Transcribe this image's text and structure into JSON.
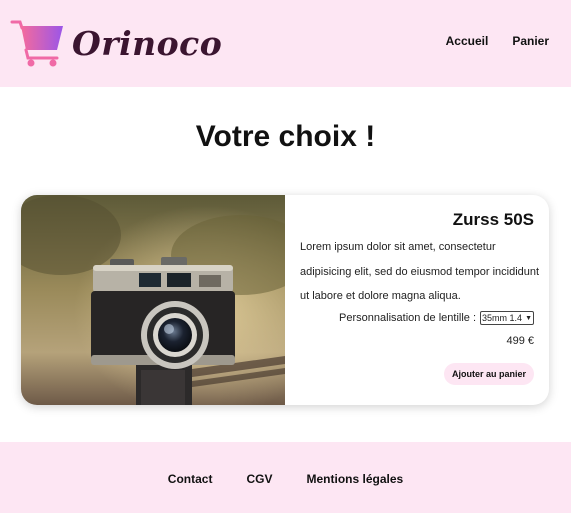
{
  "header": {
    "brand": "Orinoco",
    "nav": [
      "Accueil",
      "Panier"
    ]
  },
  "main": {
    "title": "Votre choix !"
  },
  "product": {
    "name": "Zurss 50S",
    "description": "Lorem ipsum dolor sit amet, consectetur adipisicing elit, sed do eiusmod tempor incididunt ut labore et dolore magna aliqua.",
    "lens_label": "Personnalisation de lentille :",
    "lens_selected": "35mm 1.4",
    "price": "499 €",
    "add_label": "Ajouter au panier",
    "image_icon": "camera-photo"
  },
  "footer": {
    "links": [
      "Contact",
      "CGV",
      "Mentions légales"
    ]
  },
  "colors": {
    "accent_bg": "#fde6f3",
    "brand_text": "#3b1530"
  }
}
